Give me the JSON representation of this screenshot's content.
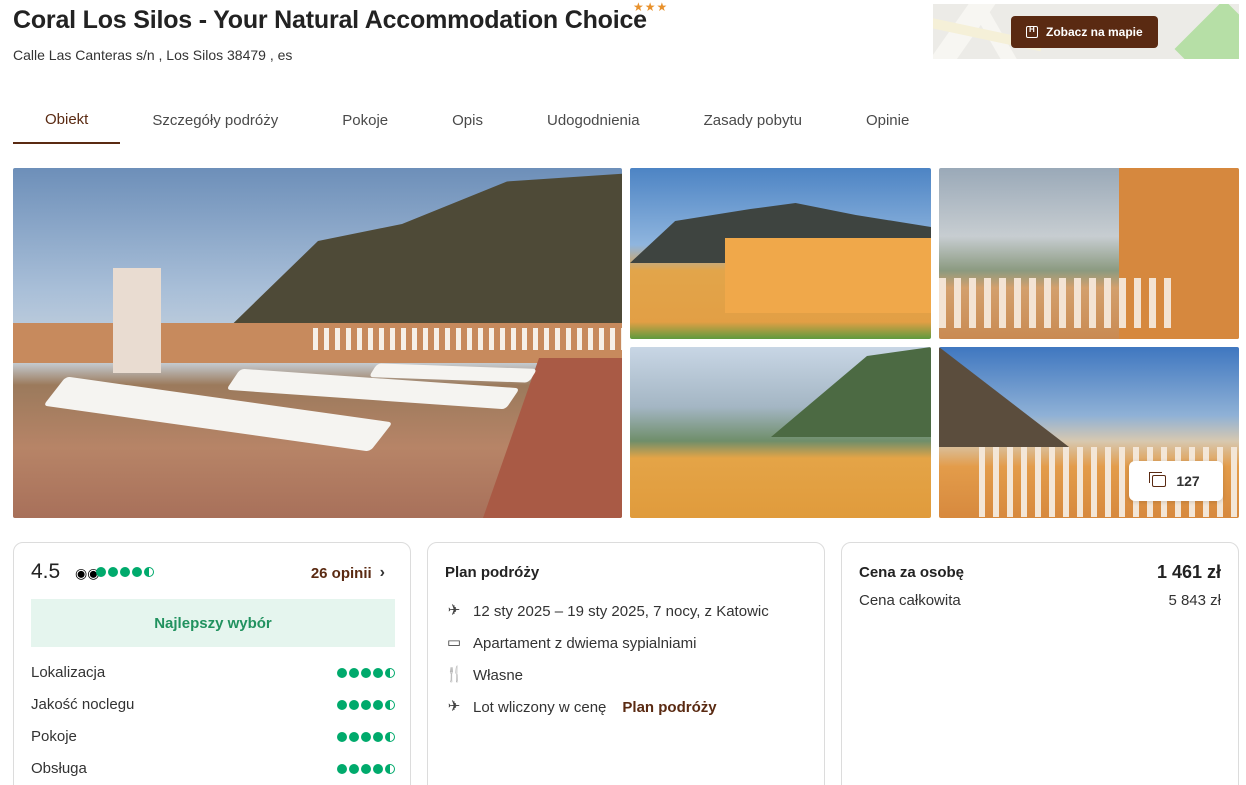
{
  "header": {
    "title": "Coral Los Silos - Your Natural Accommodation Choice",
    "stars": "★★★",
    "address": "Calle Las Canteras s/n , Los Silos 38479 , es",
    "map_button": "Zobacz na mapie"
  },
  "tabs": [
    {
      "label": "Obiekt"
    },
    {
      "label": "Szczegóły podróży"
    },
    {
      "label": "Pokoje"
    },
    {
      "label": "Opis"
    },
    {
      "label": "Udogodnienia"
    },
    {
      "label": "Zasady pobytu"
    },
    {
      "label": "Opinie"
    }
  ],
  "gallery": {
    "photo_count": "127"
  },
  "reviews_card": {
    "rating": "4.5",
    "rating_value": 4.5,
    "reviews_link": "26 opinii",
    "badge": "Najlepszy wybór",
    "categories": [
      {
        "label": "Lokalizacja",
        "score": 4.5
      },
      {
        "label": "Jakość noclegu",
        "score": 4.5
      },
      {
        "label": "Pokoje",
        "score": 4.5
      },
      {
        "label": "Obsługa",
        "score": 4.5
      }
    ]
  },
  "plan_card": {
    "title": "Plan podróży",
    "rows": [
      {
        "icon": "plane-calendar-icon",
        "text": "12 sty 2025 – 19 sty 2025, 7 nocy, z Katowic"
      },
      {
        "icon": "bed-icon",
        "text": "Apartament z dwiema sypialniami"
      },
      {
        "icon": "cutlery-icon",
        "text": "Własne"
      },
      {
        "icon": "plane-icon",
        "text": "Lot wliczony w cenę",
        "link": "Plan podróży"
      }
    ]
  },
  "price_card": {
    "per_person_label": "Cena za osobę",
    "per_person_value": "1 461 zł",
    "total_label": "Cena całkowita",
    "total_value": "5 843 zł"
  },
  "colors": {
    "brand": "#5a2a12",
    "rating_green": "#00aa6c",
    "badge_bg": "#e5f5ee",
    "star": "#e8912c"
  }
}
